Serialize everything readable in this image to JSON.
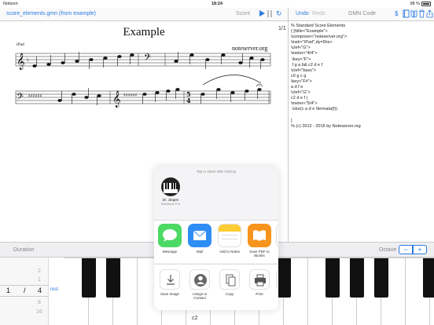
{
  "status_bar": {
    "carrier": "Notizen",
    "time": "18:24",
    "battery": "98 %"
  },
  "toolbar": {
    "filename": "score_elements.gmn (from example)",
    "score_label": "Score",
    "undo": "Undo",
    "redo": "Redo",
    "gmn_code": "GMN Code",
    "dollar": "$"
  },
  "score": {
    "page_number": "1/1",
    "title": "Example",
    "instrument": "iPad",
    "composer": "noteserver.org"
  },
  "code": {
    "lines": [
      "% Standard Score Elements",
      "{ [\\title<\"Example\">",
      "\\composer<\"noteserver.org\">",
      "\\instr<\"iPad\",dy=5hs>",
      "\\clef<\"G\">",
      "\\meter<\"4/4\">",
      " \\key<\"F\">",
      " f g a b& c2 d e f",
      "\\clef<\"bass\">",
      "c0 g c g",
      "\\key<\"F#\">",
      "a d f e",
      "\\clef<\"G\">",
      "c2 d e f |",
      "\\meter<\"5/4\">",
      " \\slur(c a d e \\fermata(f))",
      "",
      "]",
      "% (c) 2012 - 2015 by Noteserver.org"
    ]
  },
  "bottom_bar": {
    "duration_label": "Duration",
    "octave_label": "Octave",
    "minus": "−",
    "plus": "+"
  },
  "duration_picker": {
    "num_above_2": "2",
    "num_above_1": "1",
    "numerator": "1",
    "slash": "/",
    "denominator": "4",
    "den_below_1": "8",
    "den_below_2": "16",
    "rest": "rest"
  },
  "keyboard": {
    "key_label": "c2"
  },
  "share_sheet": {
    "airdrop_hint": "Tap to share with AirDrop",
    "device_name": "Dr. Jürgen",
    "device_sub": "MacBook Pro",
    "apps": [
      {
        "label": "Message",
        "icon": "message-icon",
        "color": "#4cd964"
      },
      {
        "label": "Mail",
        "icon": "mail-icon",
        "color": "#2f8ef5"
      },
      {
        "label": "Add to Notes",
        "icon": "notes-icon",
        "color": "#ffcc33"
      },
      {
        "label": "Save PDF to iBooks",
        "icon": "ibooks-icon",
        "color": "#f7941d"
      }
    ],
    "actions": [
      {
        "label": "Save Image",
        "icon": "save-image-icon"
      },
      {
        "label": "Assign to Contact",
        "icon": "contact-icon"
      },
      {
        "label": "Copy",
        "icon": "copy-icon"
      },
      {
        "label": "Print",
        "icon": "print-icon"
      }
    ]
  }
}
